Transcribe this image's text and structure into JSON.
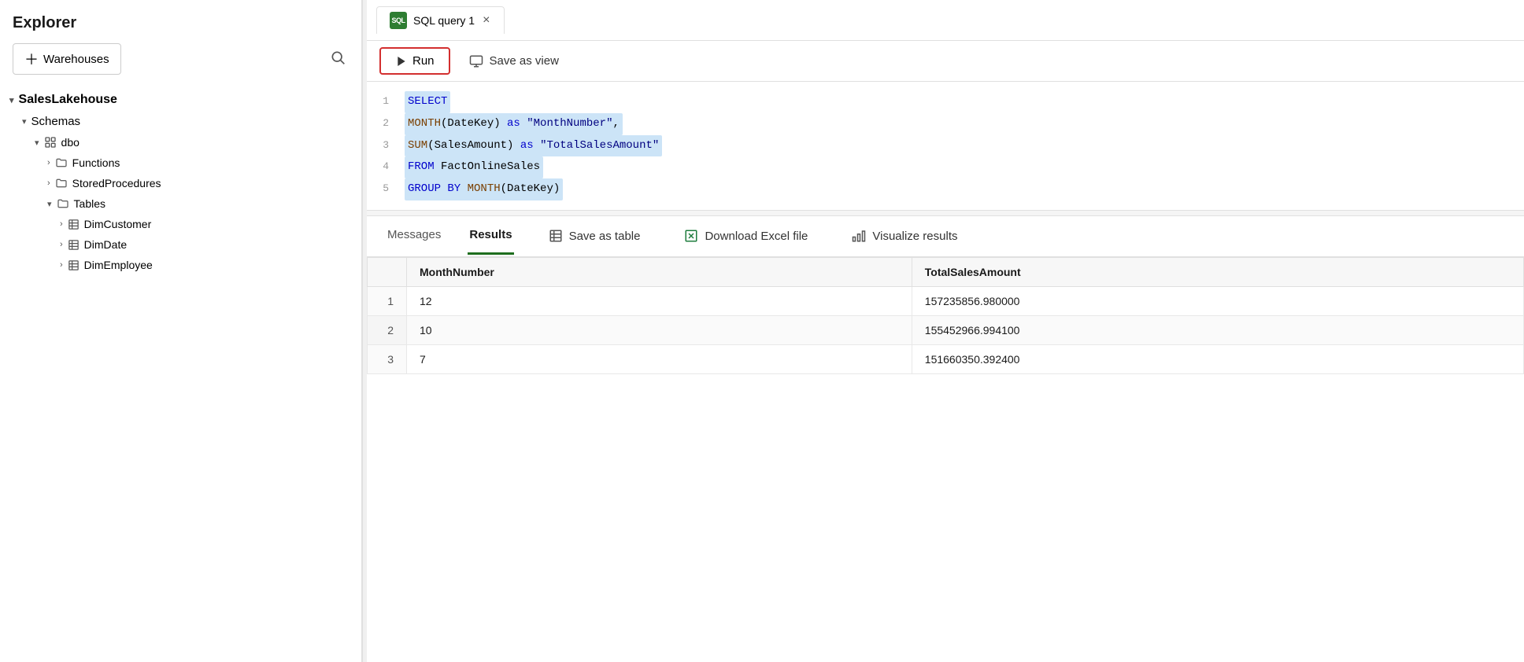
{
  "sidebar": {
    "title": "Explorer",
    "warehouses_label": "Warehouses",
    "tree": {
      "root": "SalesLakehouse",
      "schemas": "Schemas",
      "dbo": "dbo",
      "functions": "Functions",
      "stored_procedures": "StoredProcedures",
      "tables": "Tables",
      "dim_customer": "DimCustomer",
      "dim_date": "DimDate",
      "dim_employee": "DimEmployee"
    }
  },
  "tab": {
    "label": "SQL query 1",
    "close_label": "×"
  },
  "toolbar": {
    "run_label": "Run",
    "save_view_label": "Save as view"
  },
  "editor": {
    "lines": [
      {
        "num": "1",
        "content": "SELECT"
      },
      {
        "num": "2",
        "content": "MONTH(DateKey) as \"MonthNumber\","
      },
      {
        "num": "3",
        "content": "SUM(SalesAmount) as \"TotalSalesAmount\""
      },
      {
        "num": "4",
        "content": "FROM FactOnlineSales"
      },
      {
        "num": "5",
        "content": "GROUP BY MONTH(DateKey)"
      }
    ]
  },
  "results": {
    "tabs": {
      "messages": "Messages",
      "results": "Results",
      "save_as_table": "Save as table",
      "download_excel": "Download Excel file",
      "visualize": "Visualize results"
    },
    "columns": {
      "row": "",
      "month_number": "MonthNumber",
      "total_sales": "TotalSalesAmount"
    },
    "rows": [
      {
        "row": "1",
        "month": "12",
        "total": "157235856.980000"
      },
      {
        "row": "2",
        "month": "10",
        "total": "155452966.994100"
      },
      {
        "row": "3",
        "month": "7",
        "total": "151660350.392400"
      }
    ]
  }
}
